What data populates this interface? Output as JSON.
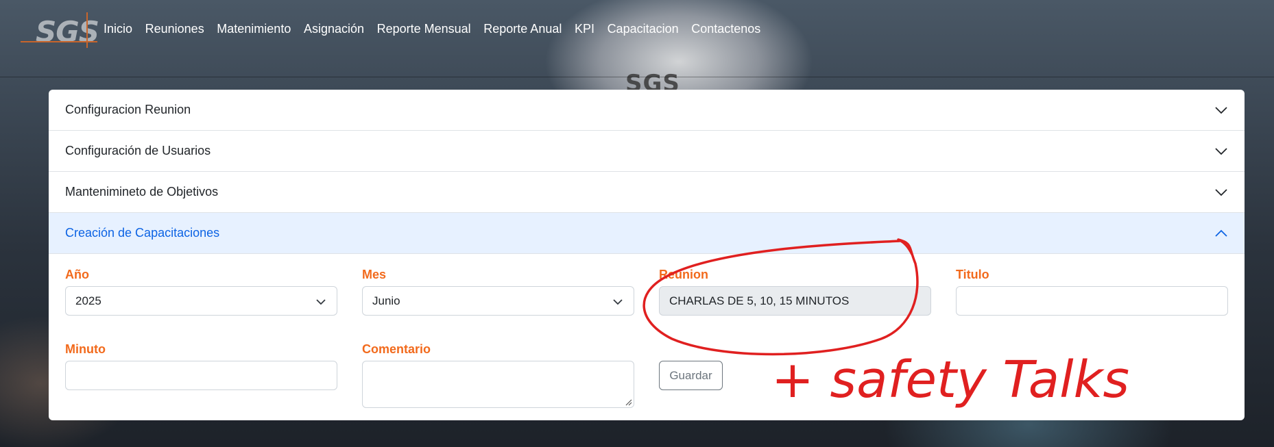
{
  "navbar": {
    "logo_text": "SGS",
    "links": [
      "Inicio",
      "Reuniones",
      "Matenimiento",
      "Asignación",
      "Reporte Mensual",
      "Reporte Anual",
      "KPI",
      "Capacitacion",
      "Contactenos"
    ]
  },
  "background": {
    "helmet_logo_text": "SGS"
  },
  "accordion": {
    "items": [
      {
        "label": "Configuracion Reunion"
      },
      {
        "label": "Configuración de Usuarios"
      },
      {
        "label": "Mantenimineto de Objetivos"
      },
      {
        "label": "Creación de Capacitaciones"
      }
    ]
  },
  "form": {
    "anio": {
      "label": "Año",
      "value": "2025"
    },
    "mes": {
      "label": "Mes",
      "value": "Junio"
    },
    "reunion": {
      "label": "Reunion",
      "value": "CHARLAS DE 5, 10, 15 MINUTOS"
    },
    "titulo": {
      "label": "Titulo",
      "value": ""
    },
    "minuto": {
      "label": "Minuto",
      "value": ""
    },
    "comentario": {
      "label": "Comentario",
      "value": ""
    },
    "save_label": "Guardar"
  },
  "annotation": {
    "text": "+ safety Talks",
    "color": "#e02020"
  },
  "colors": {
    "label_orange": "#f26a1c",
    "active_header_bg": "#e7f1ff",
    "active_header_text": "#0c63e4"
  }
}
